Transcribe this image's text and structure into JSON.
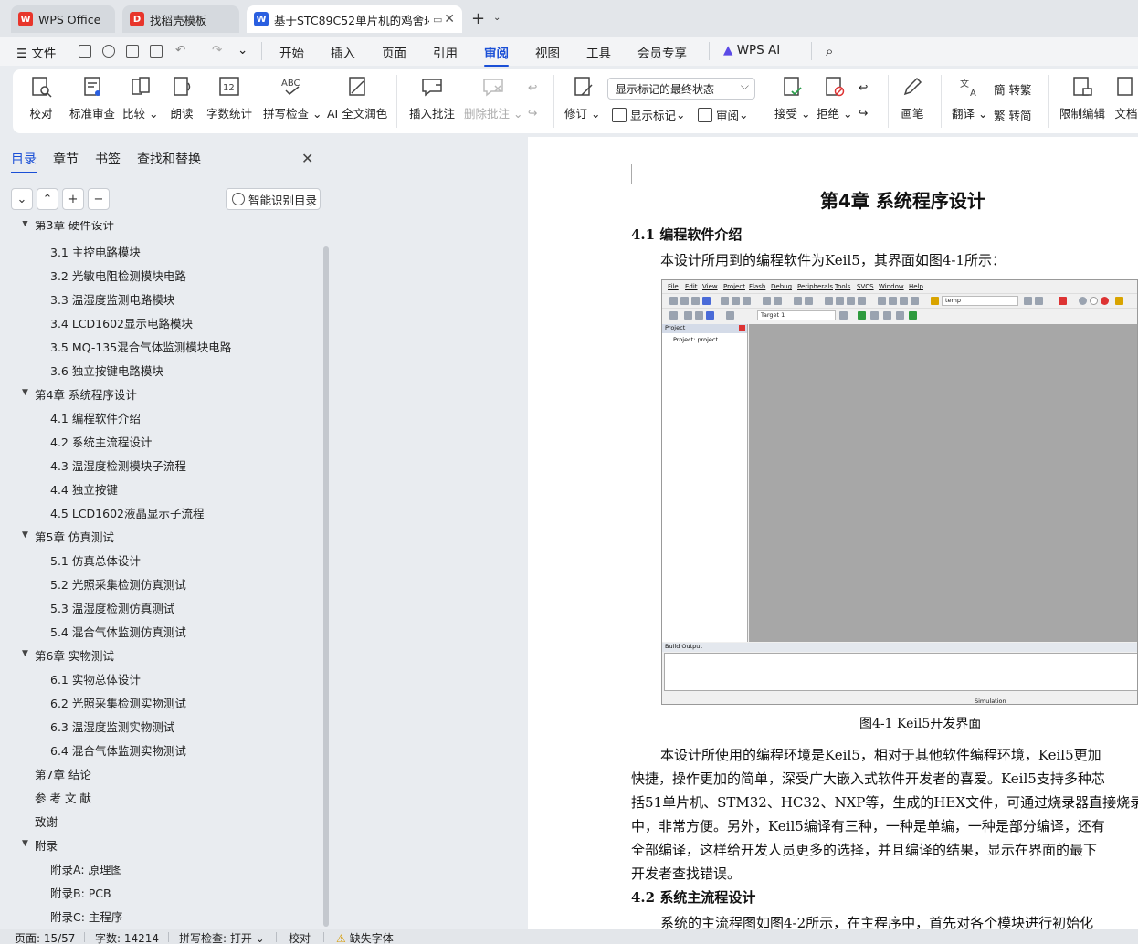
{
  "tabs": [
    {
      "label": "WPS Office",
      "icon": "wps-logo-icon"
    },
    {
      "label": "找稻壳模板",
      "icon": "docer-icon"
    },
    {
      "label": "基于STC89C52单片机的鸡舍环",
      "icon": "wps-writer-icon"
    }
  ],
  "menu": {
    "file": "文件",
    "items": [
      "开始",
      "插入",
      "页面",
      "引用",
      "审阅",
      "视图",
      "工具",
      "会员专享",
      "WPS AI"
    ],
    "active": "审阅"
  },
  "ribbon": {
    "proofread": "校对",
    "standard_review": "标准审查",
    "compare": "比较",
    "read_aloud": "朗读",
    "word_count": "字数统计",
    "spell_check": "拼写检查",
    "ai_polish": "AI 全文润色",
    "insert_comment": "插入批注",
    "delete_comment": "删除批注",
    "revise": "修订",
    "display_mode": "显示标记的最终状态",
    "show_markup": "显示标记",
    "review_pane": "审阅",
    "accept": "接受",
    "reject": "拒绝",
    "pen": "画笔",
    "translate": "翻译",
    "to_traditional": "转繁",
    "to_simplified": "转简",
    "restrict_edit": "限制编辑",
    "doc_rights": "文档"
  },
  "left_panel": {
    "tabs": [
      "目录",
      "章节",
      "书签",
      "查找和替换"
    ],
    "smart_toc": "智能识别目录",
    "toc": [
      {
        "label": "第3章  硬件设计",
        "level": 1,
        "expanded": true
      },
      {
        "label": "3.1  主控电路模块",
        "level": 2
      },
      {
        "label": "3.2  光敏电阻检测模块电路",
        "level": 2
      },
      {
        "label": "3.3  温湿度监测电路模块",
        "level": 2
      },
      {
        "label": "3.4 LCD1602显示电路模块",
        "level": 2
      },
      {
        "label": "3.5 MQ-135混合气体监测模块电路",
        "level": 2
      },
      {
        "label": "3.6  独立按键电路模块",
        "level": 2
      },
      {
        "label": "第4章  系统程序设计",
        "level": 1,
        "expanded": true
      },
      {
        "label": "4.1  编程软件介绍",
        "level": 2
      },
      {
        "label": "4.2  系统主流程设计",
        "level": 2
      },
      {
        "label": "4.3  温湿度检测模块子流程",
        "level": 2
      },
      {
        "label": "4.4  独立按键",
        "level": 2
      },
      {
        "label": "4.5 LCD1602液晶显示子流程",
        "level": 2
      },
      {
        "label": "第5章  仿真测试",
        "level": 1,
        "expanded": true
      },
      {
        "label": "5.1  仿真总体设计",
        "level": 2
      },
      {
        "label": "5.2  光照采集检测仿真测试",
        "level": 2
      },
      {
        "label": "5.3  温湿度检测仿真测试",
        "level": 2
      },
      {
        "label": "5.4  混合气体监测仿真测试",
        "level": 2
      },
      {
        "label": "第6章  实物测试",
        "level": 1,
        "expanded": true
      },
      {
        "label": "6.1  实物总体设计",
        "level": 2
      },
      {
        "label": "6.2  光照采集检测实物测试",
        "level": 2
      },
      {
        "label": "6.3  温湿度监测实物测试",
        "level": 2
      },
      {
        "label": "6.4  混合气体监测实物测试",
        "level": 2
      },
      {
        "label": "第7章  结论",
        "level": 1
      },
      {
        "label": "参 考 文 献",
        "level": 1
      },
      {
        "label": "致谢",
        "level": 1
      },
      {
        "label": "附录",
        "level": 1,
        "expanded": true
      },
      {
        "label": "附录A:  原理图",
        "level": 2
      },
      {
        "label": "附录B:  PCB",
        "level": 2
      },
      {
        "label": "附录C:  主程序",
        "level": 2
      }
    ]
  },
  "document": {
    "chapter_title": "第4章  系统程序设计",
    "sec1_title": "4.1  编程软件介绍",
    "sec1_intro": "本设计所用到的编程软件为Keil5，其界面如图4-1所示：",
    "figure_caption": "图4-1 Keil5开发界面",
    "para_lines": [
      "本设计所使用的编程环境是Keil5，相对于其他软件编程环境，Keil5更加",
      "快捷，操作更加的简单，深受广大嵌入式软件开发者的喜爱。Keil5支持多种芯",
      "括51单片机、STM32、HC32、NXP等，生成的HEX文件，可通过烧录器直接烧录到",
      "中，非常方便。另外，Keil5编译有三种，一种是单编，一种是部分编译，还有",
      "全部编译，这样给开发人员更多的选择，并且编译的结果，显示在界面的最下",
      "开发者查找错误。"
    ],
    "sec2_title": "4.2  系统主流程设计",
    "sec2_first_line": "系统的主流程图如图4-2所示，在主程序中，首先对各个模块进行初始化",
    "keil": {
      "menu": [
        "File",
        "Edit",
        "View",
        "Project",
        "Flash",
        "Debug",
        "Peripherals",
        "Tools",
        "SVCS",
        "Window",
        "Help"
      ],
      "search_text": "temp",
      "target": "Target 1",
      "project_header": "Project",
      "project_item": "Project: project",
      "build_output": "Build Output",
      "status": "Simulation"
    }
  },
  "status_bar": {
    "page": "页面: 15/57",
    "words": "字数: 14214",
    "spell": "拼写检查: 打开",
    "proof": "校对",
    "missing_font": "缺失字体"
  }
}
